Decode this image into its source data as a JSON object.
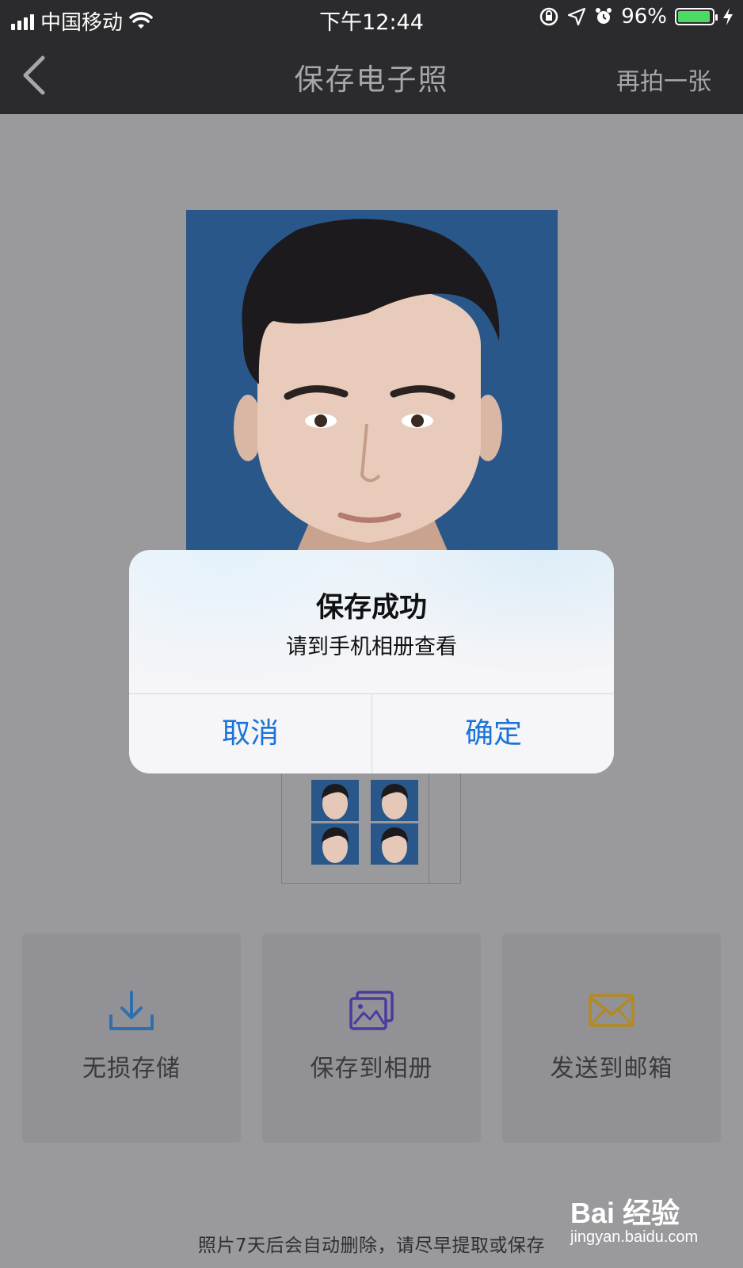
{
  "status_bar": {
    "carrier": "中国移动",
    "time": "下午12:44",
    "battery_percent": "96%",
    "battery_level": 0.96,
    "icons": [
      "signal-icon",
      "wifi-icon",
      "rotation-lock-icon",
      "location-icon",
      "alarm-icon",
      "battery-icon",
      "charging-icon"
    ]
  },
  "nav": {
    "back_icon": "chevron-left-icon",
    "title": "保存电子照",
    "retake_label": "再拍一张"
  },
  "dialog": {
    "title": "保存成功",
    "message": "请到手机相册查看",
    "cancel_label": "取消",
    "confirm_label": "确定"
  },
  "actions": [
    {
      "label": "无损存储",
      "icon": "download-icon",
      "color": "#2f6fae"
    },
    {
      "label": "保存到相册",
      "icon": "gallery-icon",
      "color": "#4b3aa0"
    },
    {
      "label": "发送到邮箱",
      "icon": "mail-icon",
      "color": "#b38a1e"
    }
  ],
  "footer_note": "照片7天后会自动删除，请尽早提取或保存",
  "watermark": {
    "brand": "Bai 经验",
    "site": "jingyan.baidu.com"
  },
  "colors": {
    "photo_background": "#2a578a",
    "dialog_button": "#1a74d8",
    "nav_bar": "#2b2b2d"
  }
}
